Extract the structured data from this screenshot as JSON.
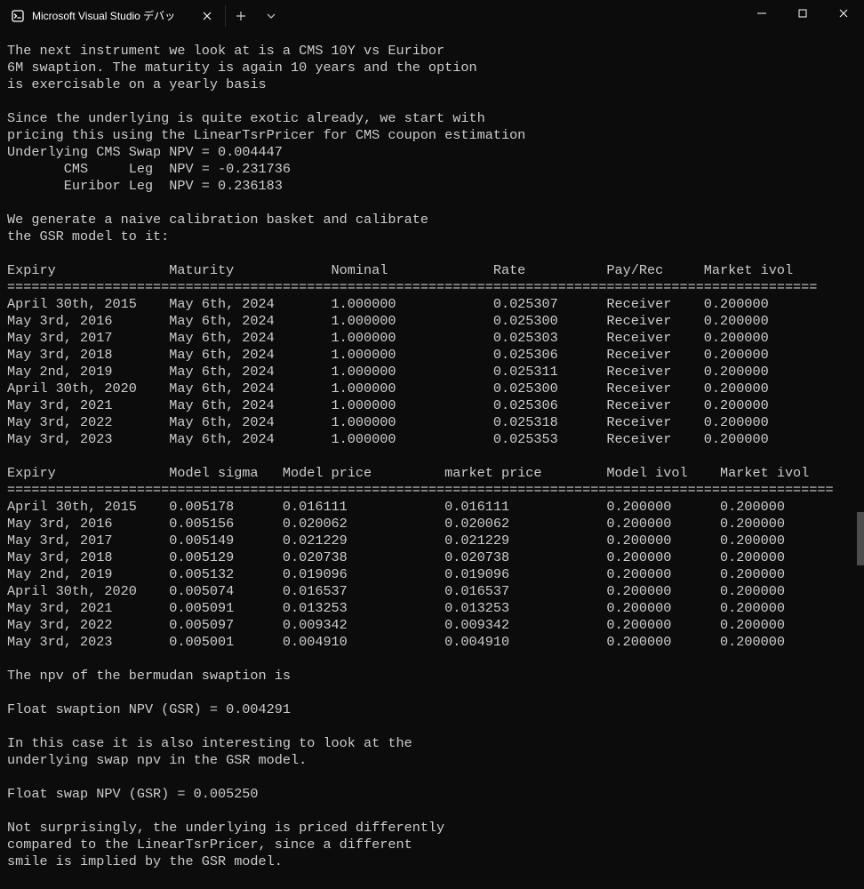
{
  "window": {
    "tab_title": "Microsoft Visual Studio デバッ",
    "new_tab_label": "+",
    "dropdown_label": "⌄",
    "min_label": "—",
    "max_label": "□",
    "close_label": "✕"
  },
  "output": {
    "intro1": "The next instrument we look at is a CMS 10Y vs Euribor",
    "intro2": "6M swaption. The maturity is again 10 years and the option",
    "intro3": "is exercisable on a yearly basis",
    "pricer1": "Since the underlying is quite exotic already, we start with",
    "pricer2": "pricing this using the LinearTsrPricer for CMS coupon estimation",
    "underlying_cms": "Underlying CMS Swap NPV = 0.004447",
    "cms_leg": "       CMS     Leg  NPV = -0.231736",
    "euribor_leg": "       Euribor Leg  NPV = 0.236183",
    "calib1": "We generate a naive calibration basket and calibrate",
    "calib2": "the GSR model to it:",
    "table1_header": "Expiry              Maturity            Nominal             Rate          Pay/Rec     Market ivol",
    "table1_rule": "====================================================================================================",
    "table1_rows": [
      "April 30th, 2015    May 6th, 2024       1.000000            0.025307      Receiver    0.200000",
      "May 3rd, 2016       May 6th, 2024       1.000000            0.025300      Receiver    0.200000",
      "May 3rd, 2017       May 6th, 2024       1.000000            0.025303      Receiver    0.200000",
      "May 3rd, 2018       May 6th, 2024       1.000000            0.025306      Receiver    0.200000",
      "May 2nd, 2019       May 6th, 2024       1.000000            0.025311      Receiver    0.200000",
      "April 30th, 2020    May 6th, 2024       1.000000            0.025300      Receiver    0.200000",
      "May 3rd, 2021       May 6th, 2024       1.000000            0.025306      Receiver    0.200000",
      "May 3rd, 2022       May 6th, 2024       1.000000            0.025318      Receiver    0.200000",
      "May 3rd, 2023       May 6th, 2024       1.000000            0.025353      Receiver    0.200000"
    ],
    "table2_header": "Expiry              Model sigma   Model price         market price        Model ivol    Market ivol",
    "table2_rule": "======================================================================================================",
    "table2_rows": [
      "April 30th, 2015    0.005178      0.016111            0.016111            0.200000      0.200000",
      "May 3rd, 2016       0.005156      0.020062            0.020062            0.200000      0.200000",
      "May 3rd, 2017       0.005149      0.021229            0.021229            0.200000      0.200000",
      "May 3rd, 2018       0.005129      0.020738            0.020738            0.200000      0.200000",
      "May 2nd, 2019       0.005132      0.019096            0.019096            0.200000      0.200000",
      "April 30th, 2020    0.005074      0.016537            0.016537            0.200000      0.200000",
      "May 3rd, 2021       0.005091      0.013253            0.013253            0.200000      0.200000",
      "May 3rd, 2022       0.005097      0.009342            0.009342            0.200000      0.200000",
      "May 3rd, 2023       0.005001      0.004910            0.004910            0.200000      0.200000"
    ],
    "npv_title": "The npv of the bermudan swaption is",
    "float_swaption": "Float swaption NPV (GSR) = 0.004291",
    "interest1": "In this case it is also interesting to look at the",
    "interest2": "underlying swap npv in the GSR model.",
    "float_swap": "Float swap NPV (GSR) = 0.005250",
    "conc1": "Not surprisingly, the underlying is priced differently",
    "conc2": "compared to the LinearTsrPricer, since a different",
    "conc3": "smile is implied by the GSR model."
  }
}
